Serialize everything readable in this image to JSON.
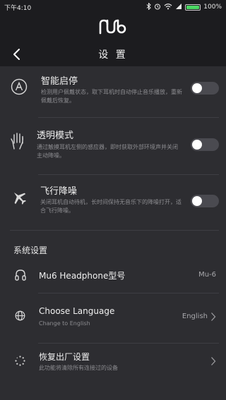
{
  "status": {
    "time": "下午4:10",
    "battery": "100%"
  },
  "header": {
    "title": "设 置",
    "logo_icon": "mu-logo-icon",
    "back_icon": "chevron-left-icon"
  },
  "settings": [
    {
      "label": "智能启停",
      "desc": "检测用户佩戴状态，取下耳机时自动停止音乐播放，重新佩戴后恢复。",
      "icon": "a-circle-icon",
      "toggle": false
    },
    {
      "label": "透明模式",
      "desc": "通过触摸耳机左侧的感应器，即时获取外部环境声并关闭主动降噪。",
      "icon": "hand-icon",
      "toggle": false
    },
    {
      "label": "飞行降噪",
      "desc": "关闭耳机自动待机，长时间保持无音乐下的降噪打开，适合飞行降噪。",
      "icon": "airplane-icon",
      "toggle": false
    }
  ],
  "system": {
    "title": "系统设置",
    "items": [
      {
        "label": "Mu6 Headphone型号",
        "value": "Mu-6",
        "sub": "",
        "icon": "headphone-icon"
      },
      {
        "label": "Choose Language",
        "value": "English",
        "sub": "Change to English",
        "icon": "globe-icon"
      },
      {
        "label": "恢复出厂设置",
        "value": "",
        "sub": "此功能将清除所有连接过的设备",
        "icon": "reset-icon"
      }
    ]
  },
  "colors": {
    "background": "#2d2d31",
    "header": "#1c1c1f",
    "toggle_off": "#4a4a50",
    "battery": "#4cd964"
  }
}
